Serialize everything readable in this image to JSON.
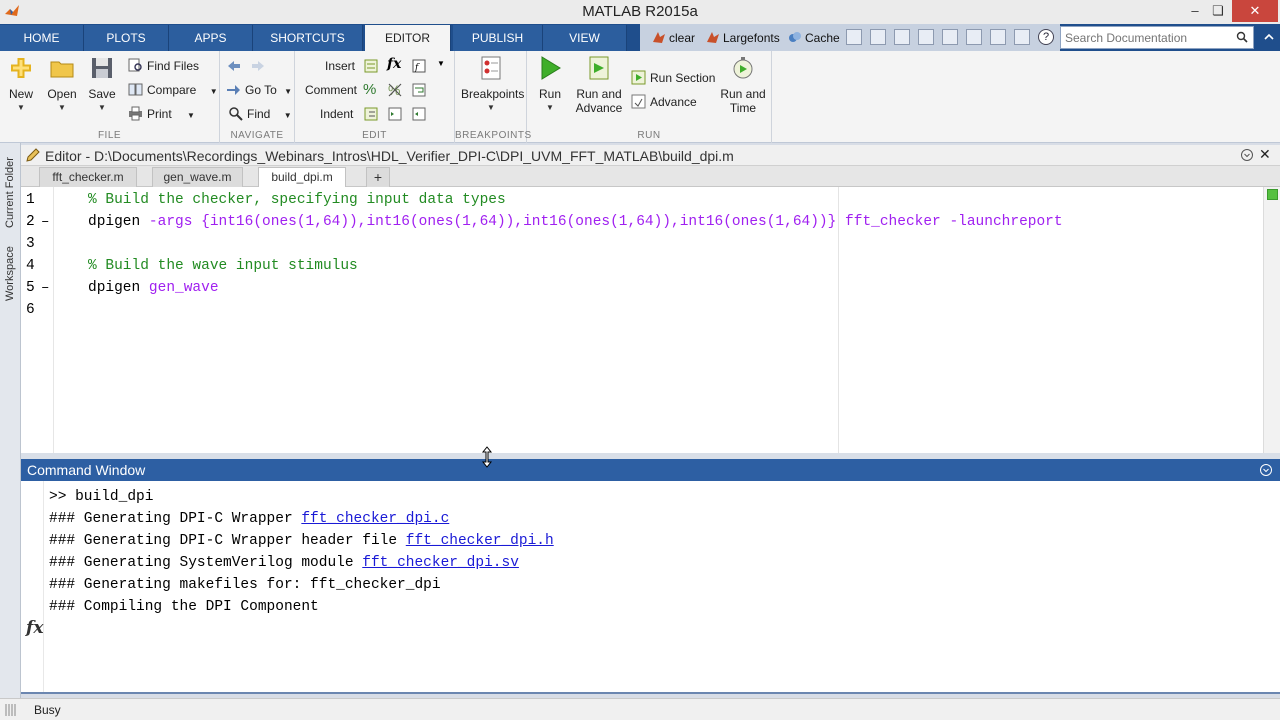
{
  "window": {
    "title": "MATLAB R2015a"
  },
  "tabs": [
    {
      "label": "HOME"
    },
    {
      "label": "PLOTS"
    },
    {
      "label": "APPS"
    },
    {
      "label": "SHORTCUTS"
    },
    {
      "label": "EDITOR"
    },
    {
      "label": "PUBLISH"
    },
    {
      "label": "VIEW"
    }
  ],
  "quickaccess": {
    "clear": "clear",
    "largefonts": "Largefonts",
    "cache": "Cache"
  },
  "search": {
    "placeholder": "Search Documentation"
  },
  "ribbon": {
    "file": {
      "label": "FILE",
      "new": "New",
      "open": "Open",
      "save": "Save",
      "find_files": "Find Files",
      "compare": "Compare",
      "print": "Print"
    },
    "navigate": {
      "label": "NAVIGATE",
      "go_to": "Go To",
      "find": "Find"
    },
    "edit": {
      "label": "EDIT",
      "insert": "Insert",
      "comment": "Comment",
      "indent": "Indent"
    },
    "breakpoints": {
      "label": "BREAKPOINTS",
      "breakpoints": "Breakpoints"
    },
    "run": {
      "label": "RUN",
      "run": "Run",
      "run_and_advance_1": "Run and",
      "run_and_advance_2": "Advance",
      "run_section": "Run Section",
      "advance": "Advance",
      "run_and_time_1": "Run and",
      "run_and_time_2": "Time"
    }
  },
  "left_panels": {
    "current_folder": "Current Folder",
    "workspace": "Workspace"
  },
  "editor": {
    "title": "Editor - D:\\Documents\\Recordings_Webinars_Intros\\HDL_Verifier_DPI-C\\DPI_UVM_FFT_MATLAB\\build_dpi.m",
    "file_tabs": [
      "fft_checker.m",
      "gen_wave.m",
      "build_dpi.m"
    ],
    "add_tab": "+",
    "line_numbers": [
      "1",
      "2",
      "3",
      "4",
      "5",
      "6"
    ],
    "code": {
      "l1": "% Build the checker, specifying input data types",
      "l2_cmd": "dpigen ",
      "l2_args": "-args {int16(ones(1,64)),int16(ones(1,64)),int16(ones(1,64)),int16(ones(1,64))} fft_checker -launchreport",
      "l4": "% Build the wave input stimulus",
      "l5_cmd": "dpigen ",
      "l5_arg": "gen_wave"
    }
  },
  "command_window": {
    "title": "Command Window",
    "lines": {
      "l1": ">> build_dpi",
      "l2_text": "### Generating DPI-C Wrapper ",
      "l2_link": "fft_checker_dpi.c",
      "l3_text": "### Generating DPI-C Wrapper header file ",
      "l3_link": "fft_checker_dpi.h",
      "l4_text": "### Generating SystemVerilog module ",
      "l4_link": "fft_checker_dpi.sv",
      "l5": "### Generating makefiles for: fft_checker_dpi",
      "l6": "### Compiling the DPI Component"
    },
    "prompt": "fx"
  },
  "status": {
    "text": "Busy"
  }
}
